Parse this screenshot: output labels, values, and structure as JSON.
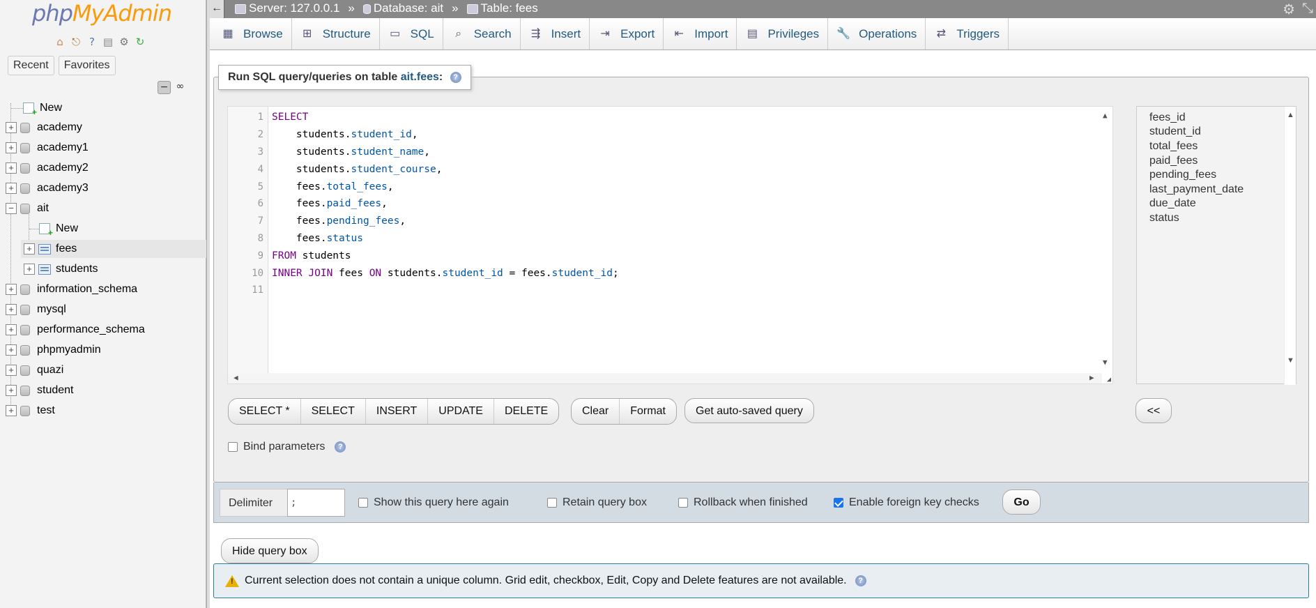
{
  "logo": {
    "part1": "php",
    "part2": "MyAdmin"
  },
  "nav": {
    "tabs": [
      "Recent",
      "Favorites"
    ],
    "icons": [
      "home-icon",
      "logout-icon",
      "help-icon",
      "docs-icon",
      "settings-icon",
      "reload-icon"
    ],
    "tree": [
      {
        "label": "New",
        "type": "new",
        "level": 0
      },
      {
        "label": "academy",
        "type": "db",
        "level": 0
      },
      {
        "label": "academy1",
        "type": "db",
        "level": 0
      },
      {
        "label": "academy2",
        "type": "db",
        "level": 0
      },
      {
        "label": "academy3",
        "type": "db",
        "level": 0
      },
      {
        "label": "ait",
        "type": "db",
        "level": 0,
        "expanded": true
      },
      {
        "label": "New",
        "type": "new",
        "level": 1
      },
      {
        "label": "fees",
        "type": "table",
        "level": 1,
        "selected": true
      },
      {
        "label": "students",
        "type": "table",
        "level": 1
      },
      {
        "label": "information_schema",
        "type": "db",
        "level": 0
      },
      {
        "label": "mysql",
        "type": "db",
        "level": 0
      },
      {
        "label": "performance_schema",
        "type": "db",
        "level": 0
      },
      {
        "label": "phpmyadmin",
        "type": "db",
        "level": 0
      },
      {
        "label": "quazi",
        "type": "db",
        "level": 0
      },
      {
        "label": "student",
        "type": "db",
        "level": 0
      },
      {
        "label": "test",
        "type": "db",
        "level": 0
      }
    ]
  },
  "breadcrumb": {
    "server": "Server: 127.0.0.1",
    "database": "Database: ait",
    "table": "Table: fees",
    "separator": "»"
  },
  "tabs": [
    {
      "label": "Browse",
      "icon": "browse-icon"
    },
    {
      "label": "Structure",
      "icon": "structure-icon"
    },
    {
      "label": "SQL",
      "icon": "sql-icon"
    },
    {
      "label": "Search",
      "icon": "search-icon"
    },
    {
      "label": "Insert",
      "icon": "insert-icon"
    },
    {
      "label": "Export",
      "icon": "export-icon"
    },
    {
      "label": "Import",
      "icon": "import-icon"
    },
    {
      "label": "Privileges",
      "icon": "privileges-icon"
    },
    {
      "label": "Operations",
      "icon": "operations-icon"
    },
    {
      "label": "Triggers",
      "icon": "triggers-icon"
    }
  ],
  "sql": {
    "legend_prefix": "Run SQL query/queries on table ",
    "legend_table": "ait.fees",
    "legend_suffix": ":",
    "line_numbers": [
      "1",
      "2",
      "3",
      "4",
      "5",
      "6",
      "7",
      "8",
      "9",
      "10",
      "11"
    ],
    "columns": [
      "fees_id",
      "student_id",
      "total_fees",
      "paid_fees",
      "pending_fees",
      "last_payment_date",
      "due_date",
      "status"
    ],
    "buttons_group1": [
      "SELECT *",
      "SELECT",
      "INSERT",
      "UPDATE",
      "DELETE"
    ],
    "buttons_group2": [
      "Clear",
      "Format"
    ],
    "autosave": "Get auto-saved query",
    "insert_col": "<<",
    "bind_params": "Bind parameters"
  },
  "footer": {
    "delimiter_label": "Delimiter",
    "delimiter_value": ";",
    "show_again": "Show this query here again",
    "retain": "Retain query box",
    "rollback": "Rollback when finished",
    "fk_checks": "Enable foreign key checks",
    "go": "Go"
  },
  "hide_query_box": "Hide query box",
  "notice": "Current selection does not contain a unique column. Grid edit, checkbox, Edit, Copy and Delete features are not available."
}
